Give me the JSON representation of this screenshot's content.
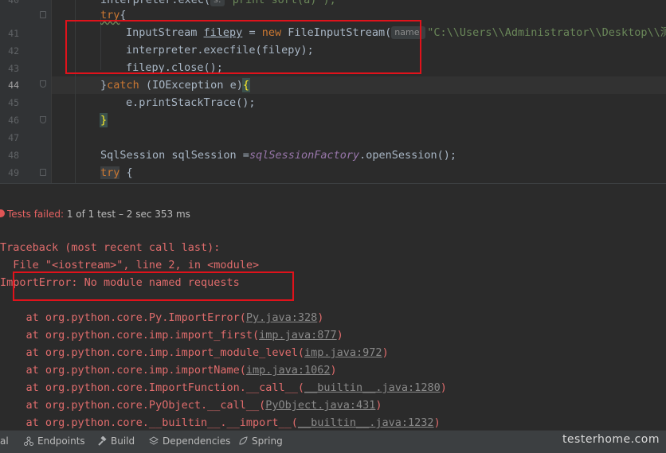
{
  "editor": {
    "line_numbers": [
      "40",
      "41",
      "42",
      "43",
      "44",
      "45",
      "46",
      "47",
      "48",
      "49"
    ],
    "active_line": "44",
    "lines": {
      "l40_a": "interpreter.exec(",
      "l40_hint": "s:",
      "l40_b": "\"print sort(a)\");",
      "l41_try": "try",
      "l41_brace": "{",
      "l42_a": "InputStream ",
      "l42_var": "filepy",
      "l42_b": " = ",
      "l42_new": "new",
      "l42_c": " FileInputStream(",
      "l42_hint": "name:",
      "l42_str": "\"C:\\\\Users\\\\Administrator\\\\Desktop\\\\测",
      "l43": "interpreter.execfile(filepy);",
      "l44": "filepy.close();",
      "l45_a": "}",
      "l45_catch": "catch",
      "l45_b": " (IOException e)",
      "l45_brace": "{",
      "l46": "e.printStackTrace();",
      "l47": "}",
      "l49_a": "SqlSession sqlSession =",
      "l49_field": "sqlSessionFactory",
      "l49_b": ".openSession();",
      "l50_try": "try",
      "l50_b": " {"
    }
  },
  "run_status": {
    "failed_label": "Tests failed:",
    "summary": " 1 of 1 test – 2 sec 353 ms"
  },
  "console": {
    "traceback": "Traceback (most recent call last):",
    "file_line": "  File \"<iostream>\", line 2, in <module>",
    "error": "ImportError: No module named requests",
    "frames": [
      {
        "prefix": "    at org.python.core.Py.ImportError(",
        "link": "Py.java:328",
        "suffix": ")"
      },
      {
        "prefix": "    at org.python.core.imp.import_first(",
        "link": "imp.java:877",
        "suffix": ")"
      },
      {
        "prefix": "    at org.python.core.imp.import_module_level(",
        "link": "imp.java:972",
        "suffix": ")"
      },
      {
        "prefix": "    at org.python.core.imp.importName(",
        "link": "imp.java:1062",
        "suffix": ")"
      },
      {
        "prefix": "    at org.python.core.ImportFunction.__call__(",
        "link": "__builtin__.java:1280",
        "suffix": ")"
      },
      {
        "prefix": "    at org.python.core.PyObject.__call__(",
        "link": "PyObject.java:431",
        "suffix": ")"
      },
      {
        "prefix": "    at org.python.core.__builtin__.__import__(",
        "link": "__builtin__.java:1232",
        "suffix": ")"
      }
    ]
  },
  "toolbar": {
    "terminal_label": "al",
    "endpoints_label": "Endpoints",
    "build_label": "Build",
    "dependencies_label": "Dependencies",
    "spring_label": "Spring",
    "watermark": "testerhome.com"
  },
  "colors": {
    "highlight_box": "#e0121b",
    "error_text": "#e06c6c",
    "keyword": "#cc7832",
    "string": "#6a8759"
  }
}
